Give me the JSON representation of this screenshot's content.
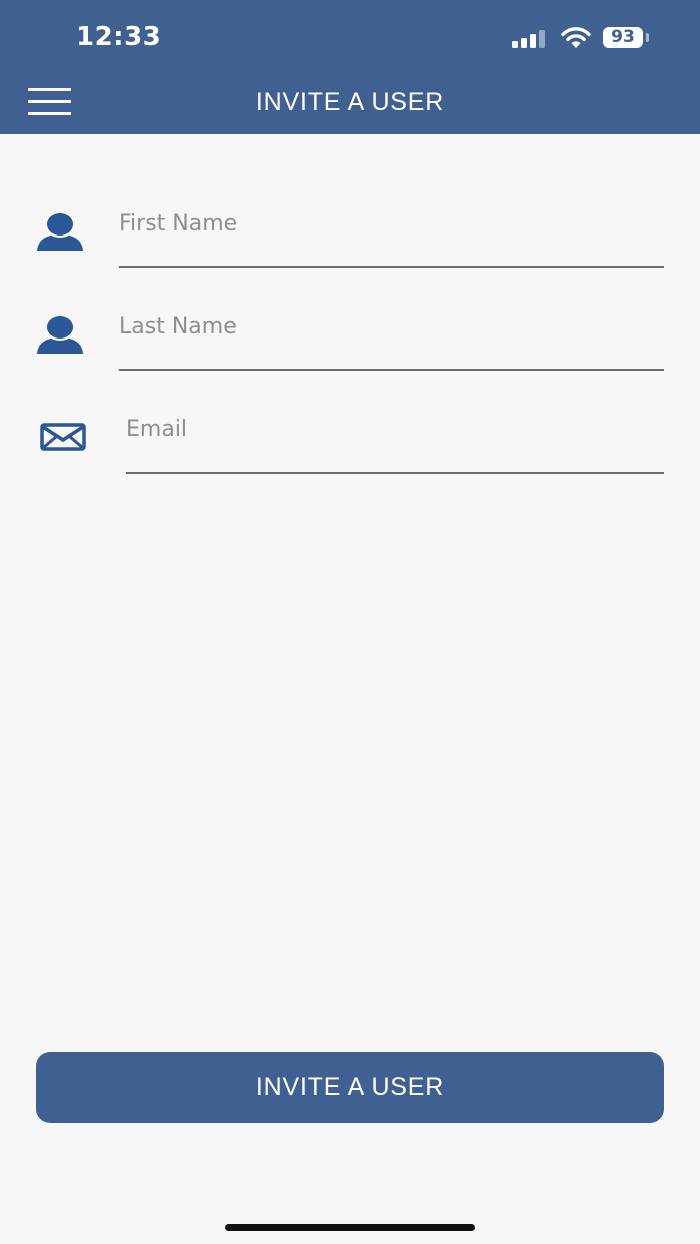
{
  "status_bar": {
    "time": "12:33",
    "battery_level": "93",
    "signal_bars_active": 3,
    "signal_bars_total": 4
  },
  "header": {
    "title": "INVITE A USER",
    "menu_icon": "hamburger-menu-icon"
  },
  "form": {
    "first_name": {
      "placeholder": "First Name",
      "value": "",
      "icon": "person-icon"
    },
    "last_name": {
      "placeholder": "Last Name",
      "value": "",
      "icon": "person-icon"
    },
    "email": {
      "placeholder": "Email",
      "value": "",
      "icon": "envelope-icon"
    }
  },
  "actions": {
    "invite_label": "INVITE A USER"
  },
  "colors": {
    "primary": "#3f6090",
    "icon_blue": "#2b5797",
    "background": "#f7f7f7",
    "placeholder": "#8e8e8e",
    "underline": "#6b6b6b"
  }
}
